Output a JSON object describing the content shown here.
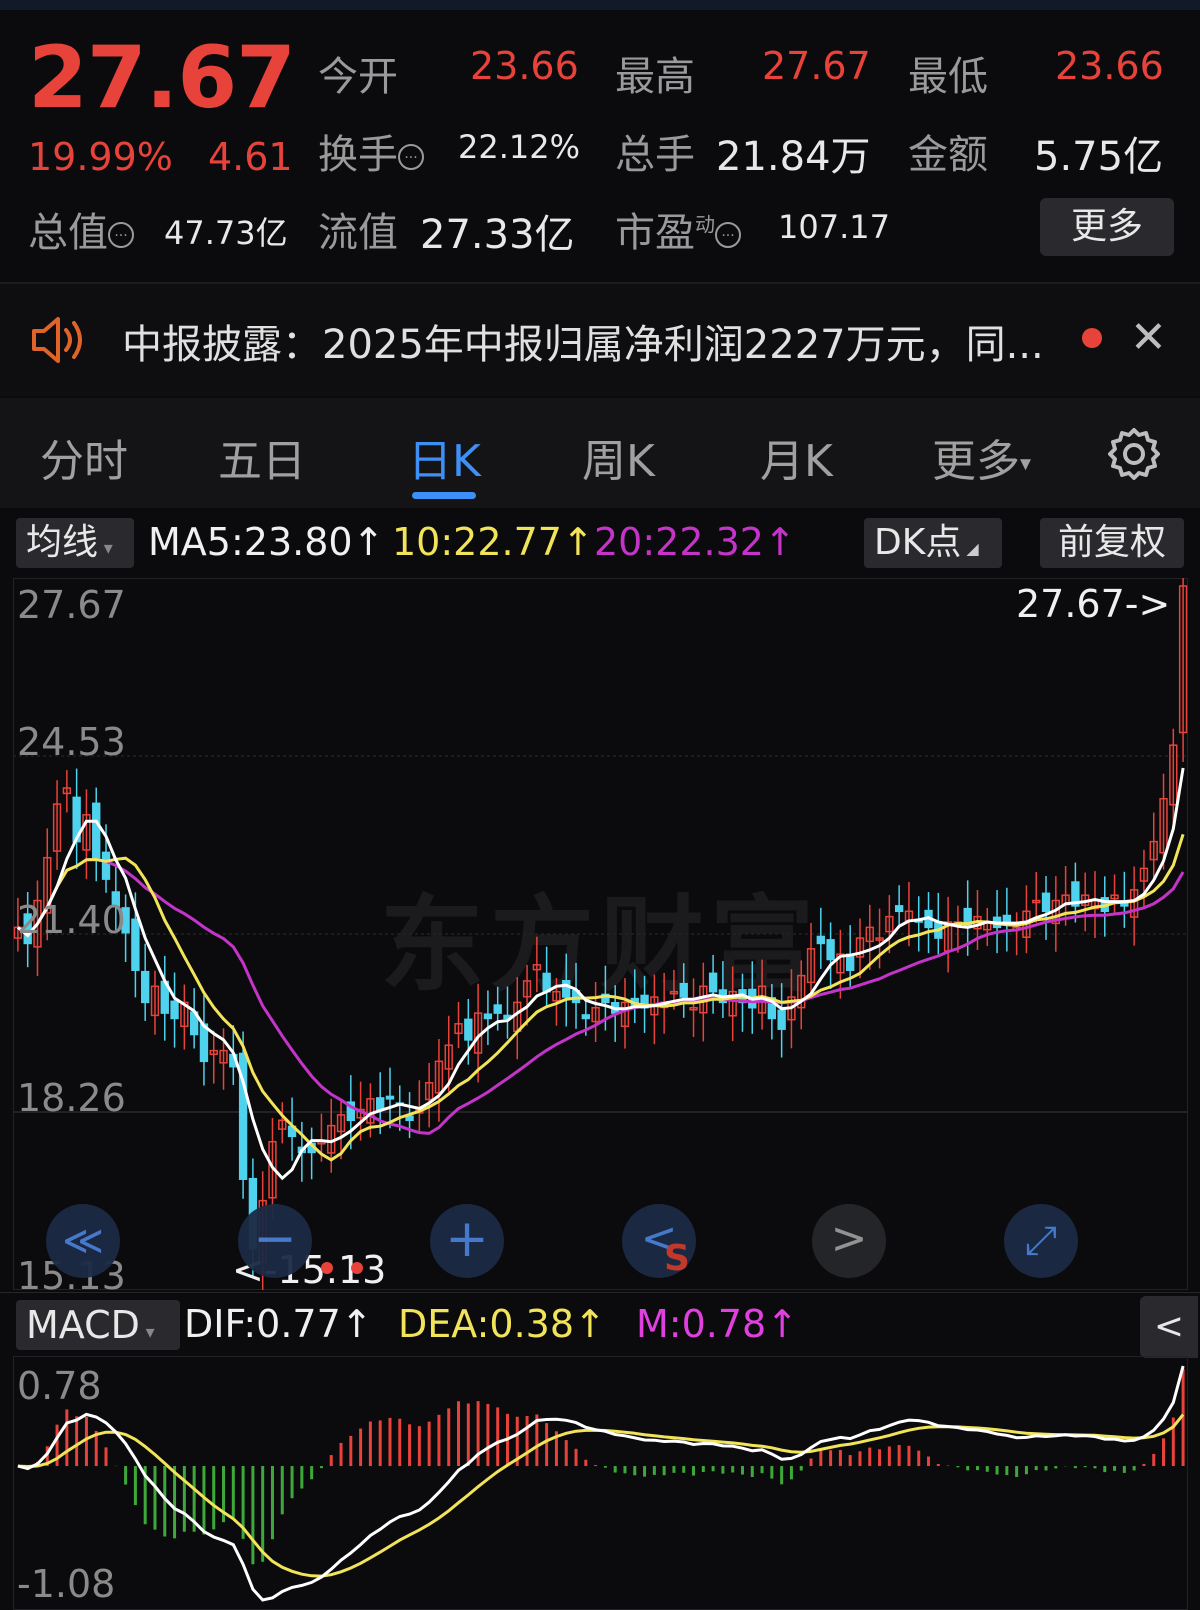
{
  "quote": {
    "price": "27.67",
    "change_pct": "19.99%",
    "change_abs": "4.61",
    "open_label": "今开",
    "open": "23.66",
    "high_label": "最高",
    "high": "27.67",
    "low_label": "最低",
    "low": "23.66",
    "turnover_label": "换手",
    "turnover": "22.12%",
    "volume_label": "总手",
    "volume": "21.84万",
    "amount_label": "金额",
    "amount": "5.75亿",
    "mktcap_label": "总值",
    "mktcap": "47.73亿",
    "float_label": "流值",
    "float_cap": "27.33亿",
    "pe_label": "市盈",
    "pe_sup": "动",
    "pe": "107.17",
    "more": "更多"
  },
  "notice": {
    "text": "中报披露：2025年中报归属净利润2227万元，同...",
    "close": "✕"
  },
  "tabs": [
    "分时",
    "五日",
    "日K",
    "周K",
    "月K",
    "更多"
  ],
  "active_tab": "日K",
  "ma_bar": {
    "selector": "均线",
    "ma5": "MA5:23.80↑",
    "ma10": "10:22.77↑",
    "ma20": "20:22.32↑",
    "dk": "DK点",
    "adjust": "前复权"
  },
  "price_axis": {
    "top": "27.67",
    "mid_high": "24.53",
    "mid": "21.40",
    "mid_low": "18.26",
    "bottom": "15.13",
    "max_marker": "27.67->",
    "min_marker": "<-15.13"
  },
  "watermark": "东方财富",
  "controls": {
    "rewind": "≪",
    "zoom_out": "−",
    "zoom_in": "+",
    "prev": "<",
    "next": ">",
    "fullscreen": "⤢",
    "s_mark": "S"
  },
  "macd_bar": {
    "selector": "MACD",
    "dif": "DIF:0.77↑",
    "dea": "DEA:0.38↑",
    "m": "M:0.78↑",
    "collapse": "<"
  },
  "macd_axis": {
    "top": "0.78",
    "bottom": "-1.08"
  },
  "colors": {
    "up": "#e8433a",
    "down": "#4fd2ee",
    "ma5": "#ffffff",
    "ma10": "#f2e45a",
    "ma20": "#c534c9",
    "accent": "#3e8ff6",
    "macd_neg": "#3fa83a"
  },
  "chart_data": {
    "type": "candlestick",
    "ylim": [
      15.13,
      27.67
    ],
    "close_series": [
      21.3,
      21.0,
      21.8,
      22.6,
      23.6,
      23.9,
      22.9,
      23.4,
      22.6,
      22.2,
      21.7,
      21.2,
      20.5,
      19.9,
      20.2,
      19.7,
      19.6,
      19.9,
      19.3,
      18.8,
      19.0,
      19.0,
      18.7,
      16.6,
      15.3,
      16.2,
      17.3,
      17.7,
      17.4,
      17.1,
      17.1,
      17.3,
      17.6,
      17.8,
      17.7,
      17.9,
      18.1,
      17.9,
      18.1,
      18.0,
      17.7,
      17.9,
      18.4,
      18.8,
      19.1,
      19.5,
      19.2,
      19.7,
      19.6,
      19.7,
      19.6,
      19.9,
      20.3,
      20.6,
      20.1,
      20.1,
      20.0,
      19.9,
      19.6,
      19.8,
      19.9,
      19.7,
      19.9,
      19.8,
      19.8,
      20.0,
      19.9,
      20.1,
      20.0,
      19.8,
      20.2,
      20.1,
      19.9,
      20.1,
      19.9,
      19.8,
      20.2,
      19.6,
      19.4,
      20.0,
      20.4,
      20.9,
      21.0,
      20.7,
      20.8,
      20.5,
      21.1,
      21.3,
      21.1,
      21.5,
      21.6,
      21.6,
      21.4,
      21.3,
      21.1,
      21.4,
      21.4,
      21.3,
      21.5,
      21.4,
      21.3,
      21.4,
      21.3,
      21.6,
      21.8,
      21.6,
      21.8,
      21.9,
      21.7,
      21.9,
      21.8,
      21.6,
      21.9,
      21.7,
      22.0,
      22.4,
      22.9,
      23.7,
      24.7,
      27.67
    ],
    "ma5_last": 23.8,
    "ma10_last": 22.77,
    "ma20_last": 22.32,
    "macd_last": {
      "dif": 0.77,
      "dea": 0.38,
      "m": 0.78
    }
  }
}
